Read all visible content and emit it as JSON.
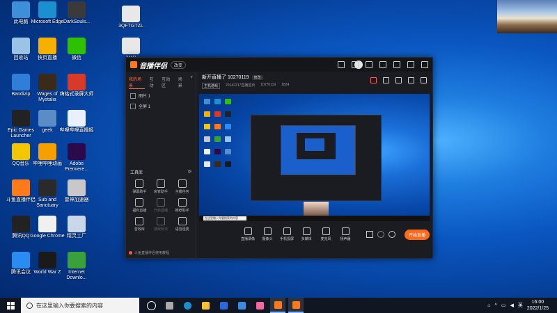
{
  "desktop": {
    "icons": [
      {
        "label": "此电脑",
        "color": "#3c8fd8"
      },
      {
        "label": "Microsoft Edge",
        "color": "#1c8fd1"
      },
      {
        "label": "DarkSouls...",
        "color": "#3a3a3a"
      },
      {
        "label": "3QFTGTZL",
        "color": "#e8e8e8"
      },
      {
        "label": "回收站",
        "color": "#9bc3e4"
      },
      {
        "label": "快页直播",
        "color": "#f5b000"
      },
      {
        "label": "微信",
        "color": "#2dc100"
      },
      {
        "label": "3MR",
        "color": "#e8e8e8"
      },
      {
        "label": "Bandizip",
        "color": "#2f7fd8"
      },
      {
        "label": "Wages of Mystalia",
        "color": "#3a2a1a"
      },
      {
        "label": "嗨格式录屏大师",
        "color": "#d83a2a"
      },
      {
        "label": "Epic Games Launcher",
        "color": "#222"
      },
      {
        "label": "geek",
        "color": "#5a8cc8"
      },
      {
        "label": "哔哩哔哩直播姬",
        "color": "#e8f0ff"
      },
      {
        "label": "QQ音乐",
        "color": "#f3c700"
      },
      {
        "label": "哔哩哔哩动画",
        "color": "#f5a000"
      },
      {
        "label": "Adobe Premiere...",
        "color": "#2a0a4a"
      },
      {
        "label": "斗鱼直播伴侣",
        "color": "#ff7a1a"
      },
      {
        "label": "Sub and Sanctuary",
        "color": "#2a2a2a"
      },
      {
        "label": "雷神加速器",
        "color": "#c8c8c8"
      },
      {
        "label": "腾讯QQ",
        "color": "#222"
      },
      {
        "label": "Google Chrome",
        "color": "#f0f0f0"
      },
      {
        "label": "精灵工厂",
        "color": "#c8d8e8"
      },
      {
        "label": "腾讯会议",
        "color": "#2a8cf0"
      },
      {
        "label": "World War Z",
        "color": "#1a1a1a"
      },
      {
        "label": "Internet Downlo...",
        "color": "#3aa03a"
      }
    ]
  },
  "app": {
    "name": "音播伴侣",
    "version_badge": "改变",
    "left_tabs": [
      "我的场景",
      "互动",
      "互动区",
      "场景"
    ],
    "scenes": [
      "图片 1",
      "全屏 1"
    ],
    "tools_header": "工具库",
    "tools": [
      {
        "label": "弹幕助手",
        "dim": false
      },
      {
        "label": "房管助手",
        "dim": false
      },
      {
        "label": "主播任务",
        "dim": false
      },
      {
        "label": "福利直播",
        "dim": false
      },
      {
        "label": "开启直播",
        "dim": true
      },
      {
        "label": "推荐助手",
        "dim": false
      },
      {
        "label": "音效库",
        "dim": false
      },
      {
        "label": "游戏玩法",
        "dim": true
      },
      {
        "label": "语音连麦",
        "dim": false
      }
    ],
    "left_footer": "斗鱼直播伴侣使用教程",
    "room_title": "新开直播了 10270119",
    "room_tag": "修改",
    "room_category": "主机游戏",
    "room_meta_1": "20142217直播首页",
    "room_meta_2": "10270119",
    "room_meta_3": "1824",
    "controls": [
      "直播录像",
      "摄像头",
      "手机投屏",
      "多媒体",
      "麦克风",
      "扬声器"
    ],
    "go_live": "开始直播",
    "preview_search": "在这里输入你要搜索的内容"
  },
  "taskbar": {
    "search_placeholder": "在这里输入你要搜索的内容",
    "ime": "英",
    "time": "16:00",
    "date": "2022/1/25"
  }
}
